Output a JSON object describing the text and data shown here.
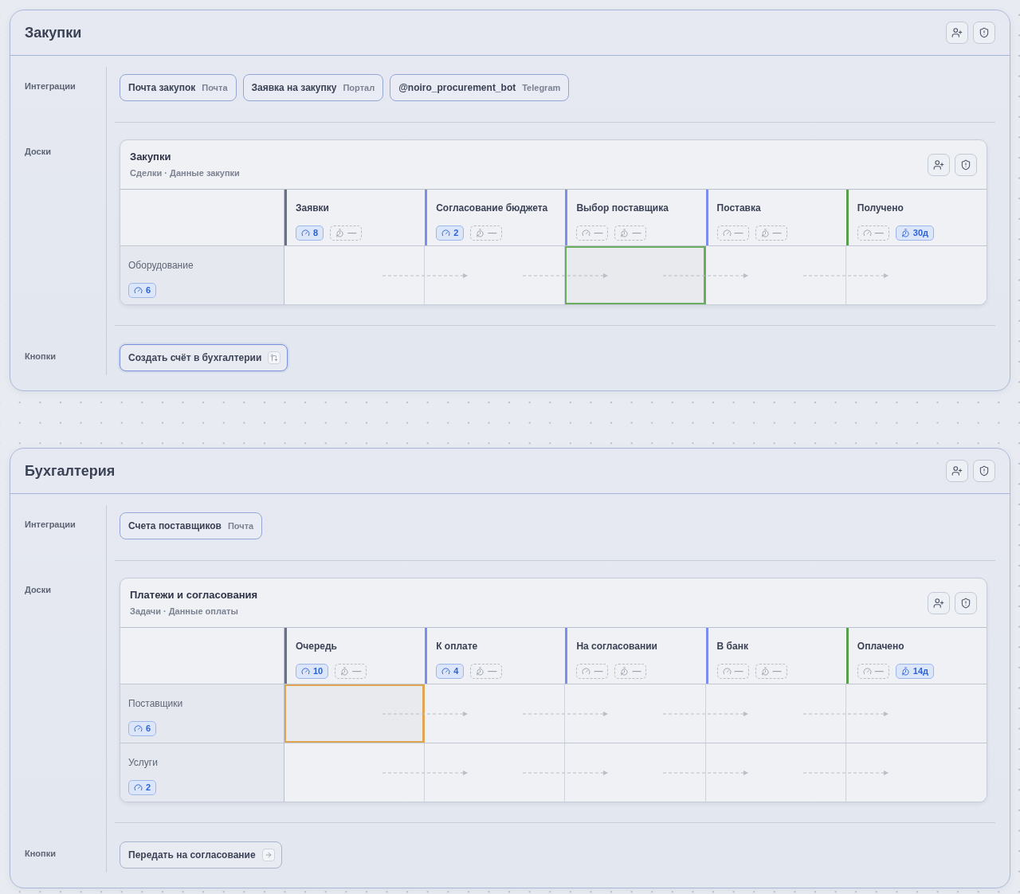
{
  "sections": [
    {
      "title": "Закупки",
      "integrations": {
        "label": "Интеграции",
        "items": [
          {
            "name": "Почта закупок",
            "channel": "Почта"
          },
          {
            "name": "Заявка на закупку",
            "channel": "Портал"
          },
          {
            "name": "@noiro_procurement_bot",
            "channel": "Telegram"
          }
        ]
      },
      "boards": {
        "label": "Доски",
        "items": [
          {
            "title": "Закупки",
            "subtitle": "Сделки · Данные закупки",
            "columns": [
              {
                "name": "Заявки",
                "color": "#6b7183",
                "load": {
                  "value": "8",
                  "active": true
                },
                "time": {
                  "value": "—",
                  "active": false
                }
              },
              {
                "name": "Согласование бюджета",
                "color": "#7b8ef0",
                "load": {
                  "value": "2",
                  "active": true
                },
                "time": {
                  "value": "—",
                  "active": false
                }
              },
              {
                "name": "Выбор поставщика",
                "color": "#7b8ef0",
                "load": {
                  "value": "—",
                  "active": false
                },
                "time": {
                  "value": "—",
                  "active": false
                }
              },
              {
                "name": "Поставка",
                "color": "#7b8ef0",
                "load": {
                  "value": "—",
                  "active": false
                },
                "time": {
                  "value": "—",
                  "active": false
                }
              },
              {
                "name": "Получено",
                "color": "#5a9e4c",
                "load": {
                  "value": "—",
                  "active": false
                },
                "time": {
                  "value": "30д",
                  "active": true
                }
              }
            ],
            "lanes": [
              {
                "name": "Оборудование",
                "load": {
                  "value": "6",
                  "active": true
                },
                "cells": [
                  {
                    "marked": false
                  },
                  {
                    "marked": false
                  },
                  {
                    "marked": true,
                    "color": "#6aad5e"
                  },
                  {
                    "marked": false
                  },
                  {
                    "marked": false
                  }
                ]
              }
            ]
          }
        ]
      },
      "buttons": {
        "label": "Кнопки",
        "items": [
          {
            "label": "Создать счёт в бухгалтерии",
            "kind": "branch",
            "focused": true
          }
        ]
      }
    },
    {
      "title": "Бухгалтерия",
      "integrations": {
        "label": "Интеграции",
        "items": [
          {
            "name": "Счета поставщиков",
            "channel": "Почта"
          }
        ]
      },
      "boards": {
        "label": "Доски",
        "items": [
          {
            "title": "Платежи и согласования",
            "subtitle": "Задачи · Данные оплаты",
            "columns": [
              {
                "name": "Очередь",
                "color": "#6b7183",
                "load": {
                  "value": "10",
                  "active": true
                },
                "time": {
                  "value": "—",
                  "active": false
                }
              },
              {
                "name": "К оплате",
                "color": "#7b8ef0",
                "load": {
                  "value": "4",
                  "active": true
                },
                "time": {
                  "value": "—",
                  "active": false
                }
              },
              {
                "name": "На согласовании",
                "color": "#7b8ef0",
                "load": {
                  "value": "—",
                  "active": false
                },
                "time": {
                  "value": "—",
                  "active": false
                }
              },
              {
                "name": "В банк",
                "color": "#7b8ef0",
                "load": {
                  "value": "—",
                  "active": false
                },
                "time": {
                  "value": "—",
                  "active": false
                }
              },
              {
                "name": "Оплачено",
                "color": "#5a9e4c",
                "load": {
                  "value": "—",
                  "active": false
                },
                "time": {
                  "value": "14д",
                  "active": true
                }
              }
            ],
            "lanes": [
              {
                "name": "Поставщики",
                "load": {
                  "value": "6",
                  "active": true
                },
                "cells": [
                  {
                    "marked": true,
                    "color": "#e0a552"
                  },
                  {
                    "marked": false
                  },
                  {
                    "marked": false
                  },
                  {
                    "marked": false
                  },
                  {
                    "marked": false
                  }
                ]
              },
              {
                "name": "Услуги",
                "load": {
                  "value": "2",
                  "active": true
                },
                "cells": [
                  {
                    "marked": false
                  },
                  {
                    "marked": false
                  },
                  {
                    "marked": false
                  },
                  {
                    "marked": false
                  },
                  {
                    "marked": false
                  }
                ]
              }
            ]
          }
        ]
      },
      "buttons": {
        "label": "Кнопки",
        "items": [
          {
            "label": "Передать на согласование",
            "kind": "forward",
            "focused": false
          }
        ]
      }
    }
  ]
}
